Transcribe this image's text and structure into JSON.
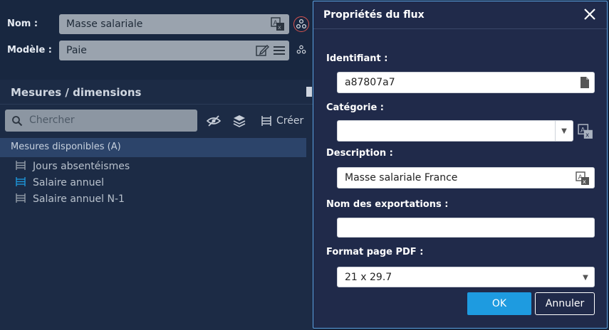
{
  "form": {
    "name_label": "Nom :",
    "name_value": "Masse salariale",
    "model_label": "Modèle :",
    "model_value": "Paie"
  },
  "panel": {
    "title": "Mesures / dimensions",
    "search_placeholder": "Chercher",
    "create_label": "Créer",
    "list_header": "Mesures disponibles (A)",
    "items": [
      {
        "label": "Jours absentéismes",
        "color": "#9aa3ae"
      },
      {
        "label": "Salaire annuel",
        "color": "#1e9be0"
      },
      {
        "label": "Salaire annuel N-1",
        "color": "#9aa3ae"
      }
    ]
  },
  "dialog": {
    "title": "Propriétés du flux",
    "id_label": "Identifiant :",
    "id_value": "a87807a7",
    "category_label": "Catégorie :",
    "category_value": "",
    "description_label": "Description :",
    "description_value": "Masse salariale France",
    "export_label": "Nom des exportations :",
    "export_value": "",
    "pdf_label": "Format page PDF :",
    "pdf_value": "21 x 29.7",
    "ok_label": "OK",
    "cancel_label": "Annuler"
  },
  "colors": {
    "accent": "#1e9be0",
    "dialog_bg": "#202a4a",
    "page_bg": "#152238"
  }
}
